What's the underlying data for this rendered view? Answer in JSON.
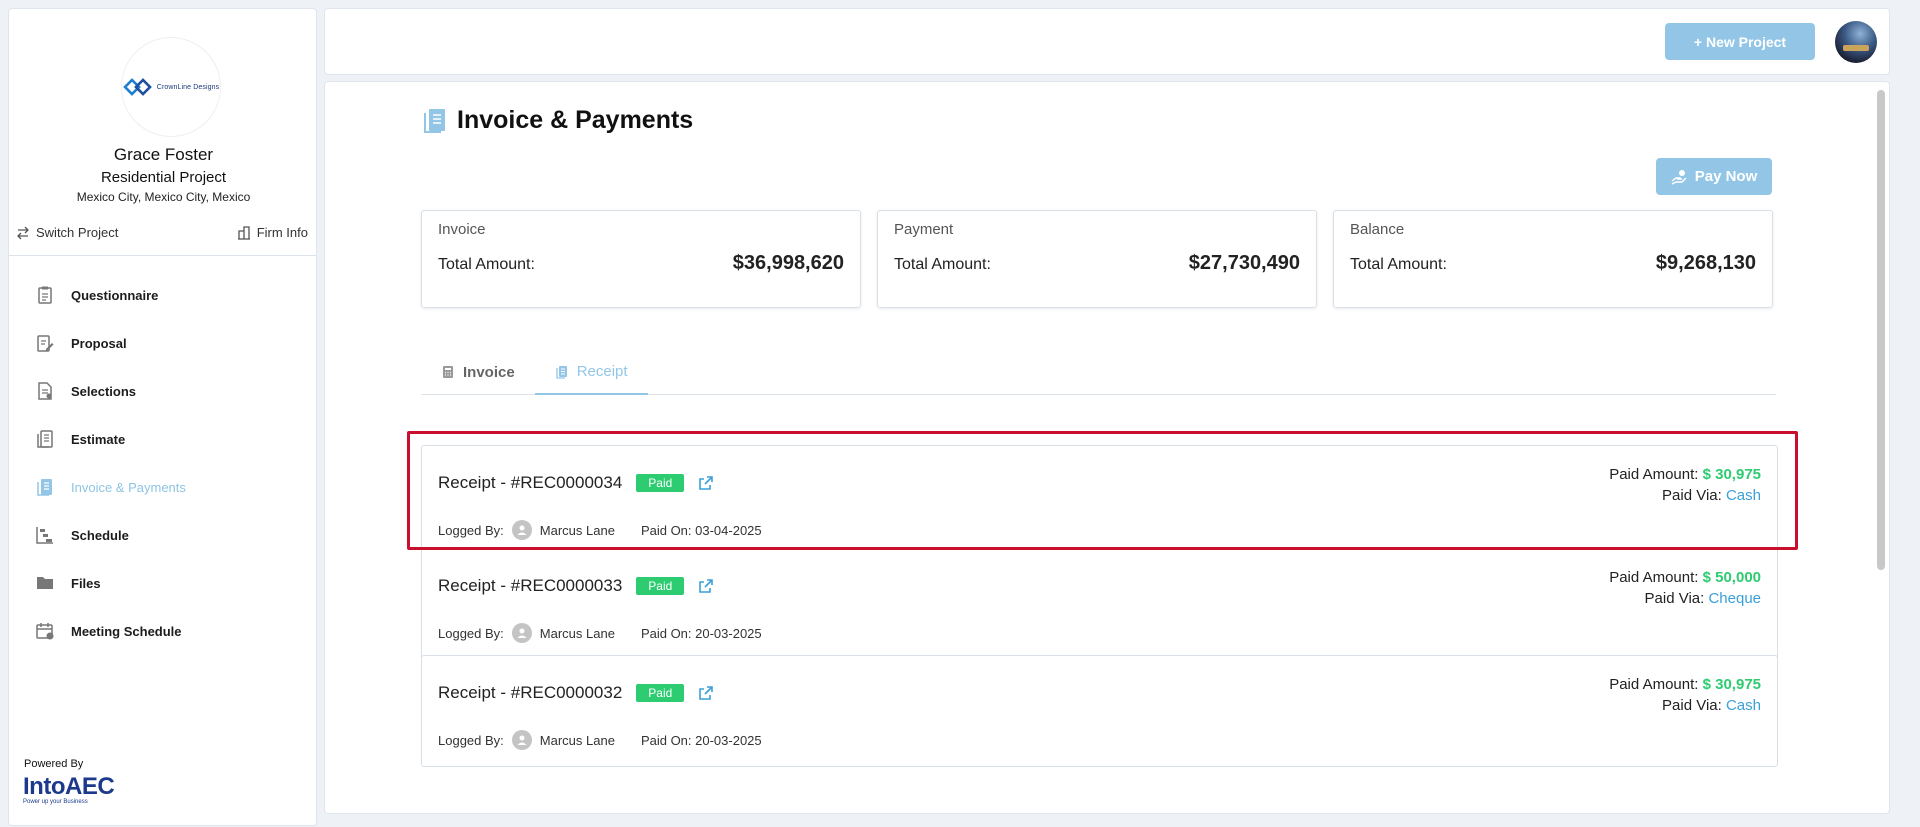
{
  "sidebar": {
    "logo_text": "CrownLine Designs",
    "client_name": "Grace Foster",
    "project_type": "Residential Project",
    "location": "Mexico City, Mexico City, Mexico",
    "switch_project": "Switch Project",
    "firm_info": "Firm Info",
    "nav": [
      {
        "label": "Questionnaire",
        "icon": "clipboard-icon"
      },
      {
        "label": "Proposal",
        "icon": "proposal-edit-icon"
      },
      {
        "label": "Selections",
        "icon": "selections-icon"
      },
      {
        "label": "Estimate",
        "icon": "estimate-icon"
      },
      {
        "label": "Invoice & Payments",
        "icon": "receipt-icon",
        "active": true
      },
      {
        "label": "Schedule",
        "icon": "schedule-icon"
      },
      {
        "label": "Files",
        "icon": "folder-icon"
      },
      {
        "label": "Meeting Schedule",
        "icon": "calendar-icon"
      }
    ],
    "powered_by": "Powered By",
    "brand": "IntoAEC",
    "brand_tagline": "Power up your Business"
  },
  "header": {
    "new_project": "+ New Project"
  },
  "main": {
    "title": "Invoice & Payments",
    "pay_now": "Pay Now",
    "cards": [
      {
        "title": "Invoice",
        "label": "Total Amount:",
        "value": "$36,998,620"
      },
      {
        "title": "Payment",
        "label": "Total Amount:",
        "value": "$27,730,490"
      },
      {
        "title": "Balance",
        "label": "Total Amount:",
        "value": "$9,268,130"
      }
    ],
    "tabs": [
      {
        "label": "Invoice",
        "active": false
      },
      {
        "label": "Receipt",
        "active": true
      }
    ],
    "receipts": [
      {
        "title": "Receipt - #REC0000034",
        "status": "Paid",
        "logged_by_label": "Logged By:",
        "logged_by": "Marcus Lane",
        "paid_on": "Paid On: 03-04-2025",
        "amount_label": "Paid Amount:",
        "amount": "$ 30,975",
        "via_label": "Paid Via:",
        "via": "Cash"
      },
      {
        "title": "Receipt - #REC0000033",
        "status": "Paid",
        "logged_by_label": "Logged By:",
        "logged_by": "Marcus Lane",
        "paid_on": "Paid On: 20-03-2025",
        "amount_label": "Paid Amount:",
        "amount": "$ 50,000",
        "via_label": "Paid Via:",
        "via": "Cheque"
      },
      {
        "title": "Receipt - #REC0000032",
        "status": "Paid",
        "logged_by_label": "Logged By:",
        "logged_by": "Marcus Lane",
        "paid_on": "Paid On: 20-03-2025",
        "amount_label": "Paid Amount:",
        "amount": "$ 30,975",
        "via_label": "Paid Via:",
        "via": "Cash"
      }
    ]
  },
  "colors": {
    "accent": "#93c6e6",
    "paid": "#2ecc71",
    "link": "#3aa0d8",
    "highlight": "#c8102e"
  }
}
